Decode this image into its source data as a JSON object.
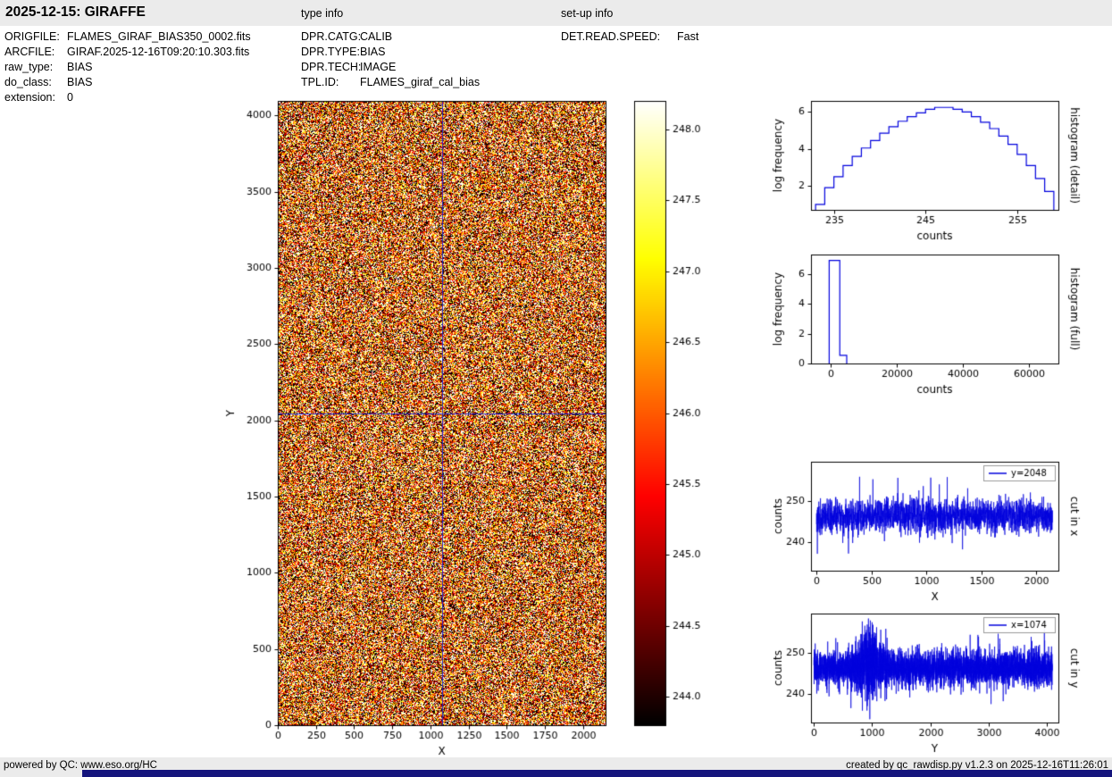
{
  "header": {
    "title": "2025-12-15: GIRAFFE",
    "type_info_label": "type info",
    "setup_info_label": "set-up info"
  },
  "file_info": [
    {
      "label": "ORIGFILE:",
      "value": "FLAMES_GIRAF_BIAS350_0002.fits"
    },
    {
      "label": "ARCFILE:",
      "value": "GIRAF.2025-12-16T09:20:10.303.fits"
    },
    {
      "label": "raw_type:",
      "value": "BIAS"
    },
    {
      "label": "do_class:",
      "value": "BIAS"
    },
    {
      "label": "extension:",
      "value": "0"
    }
  ],
  "type_info": [
    {
      "label": "DPR.CATG:",
      "value": "CALIB"
    },
    {
      "label": "DPR.TYPE:",
      "value": "BIAS"
    },
    {
      "label": "DPR.TECH:",
      "value": "IMAGE"
    },
    {
      "label": "TPL.ID:",
      "value": "FLAMES_giraf_cal_bias"
    }
  ],
  "setup_info": [
    {
      "label": "DET.READ.SPEED:",
      "value": "Fast"
    }
  ],
  "footer": {
    "left": "powered by QC: www.eso.org/HC",
    "right": "created by qc_rawdisp.py v1.2.3 on 2025-12-16T11:26:01"
  },
  "colors": {
    "plot_line": "#0000dd",
    "crosshair": "#2222cc",
    "header_bg": "#ebebeb",
    "footer_accent": "#15157d"
  },
  "chart_data": [
    {
      "id": "bias_image",
      "type": "heatmap",
      "xlabel": "X",
      "ylabel": "Y",
      "xlim": [
        0,
        2148
      ],
      "ylim": [
        0,
        4096
      ],
      "xticks": [
        0,
        250,
        500,
        750,
        1000,
        1250,
        1500,
        1750,
        2000
      ],
      "yticks": [
        0,
        500,
        1000,
        1500,
        2000,
        2500,
        3000,
        3500,
        4000
      ],
      "colormap": "hot",
      "vmin": 243.8,
      "vmax": 248.2,
      "noise_mean": 246.0,
      "noise_sigma": 2.2,
      "seed": 12345,
      "crosshair_x": 1074,
      "crosshair_y": 2048
    },
    {
      "id": "colorbar",
      "type": "colorbar",
      "colormap": "hot",
      "vmin": 243.8,
      "vmax": 248.2,
      "ticks": [
        244.0,
        244.5,
        245.0,
        245.5,
        246.0,
        246.5,
        247.0,
        247.5,
        248.0
      ]
    },
    {
      "id": "hist_detail",
      "type": "step-histogram",
      "xlabel": "counts",
      "ylabel": "log frequency",
      "right_label": "histogram (detail)",
      "xlim": [
        232.5,
        259.5
      ],
      "ylim": [
        0.7,
        6.6
      ],
      "xticks": [
        235,
        245,
        255
      ],
      "yticks": [
        2,
        4,
        6
      ],
      "bin_edges": [
        233,
        234,
        235,
        236,
        237,
        238,
        239,
        240,
        241,
        242,
        243,
        244,
        245,
        246,
        247,
        248,
        249,
        250,
        251,
        252,
        253,
        254,
        255,
        256,
        257,
        258,
        259
      ],
      "log_counts": [
        1.0,
        1.9,
        2.5,
        3.1,
        3.6,
        4.05,
        4.45,
        4.85,
        5.2,
        5.5,
        5.75,
        5.95,
        6.15,
        6.25,
        6.25,
        6.15,
        6.0,
        5.75,
        5.45,
        5.1,
        4.7,
        4.25,
        3.7,
        3.1,
        2.4,
        1.7
      ]
    },
    {
      "id": "hist_full",
      "type": "step-histogram",
      "xlabel": "counts",
      "ylabel": "log frequency",
      "right_label": "histogram (full)",
      "xlim": [
        -6000,
        68800
      ],
      "ylim": [
        0,
        7.3
      ],
      "xticks": [
        0,
        20000,
        40000,
        60000
      ],
      "yticks": [
        0,
        2,
        4,
        6
      ],
      "bin_edges": [
        -500,
        2700,
        4800
      ],
      "log_counts": [
        6.9,
        0.55
      ]
    },
    {
      "id": "cut_x",
      "type": "line",
      "legend": "y=2048",
      "xlabel": "X",
      "ylabel": "counts",
      "right_label": "cut in x",
      "xlim": [
        -50,
        2200
      ],
      "ylim": [
        233,
        259.5
      ],
      "xticks": [
        0,
        500,
        1000,
        1500,
        2000
      ],
      "yticks": [
        240,
        250
      ],
      "n_points": 2148,
      "mean": 246.3,
      "sigma": 2.1,
      "seed": 42
    },
    {
      "id": "cut_y",
      "type": "line",
      "legend": "x=1074",
      "xlabel": "Y",
      "ylabel": "counts",
      "right_label": "cut in y",
      "xlim": [
        -50,
        4200
      ],
      "ylim": [
        233,
        259.5
      ],
      "xticks": [
        0,
        1000,
        2000,
        3000,
        4000
      ],
      "yticks": [
        240,
        250
      ],
      "n_points": 4096,
      "mean": 246.2,
      "sigma": 2.1,
      "seed": 77,
      "bump": {
        "center": 950,
        "width": 150,
        "height": 3
      }
    }
  ]
}
